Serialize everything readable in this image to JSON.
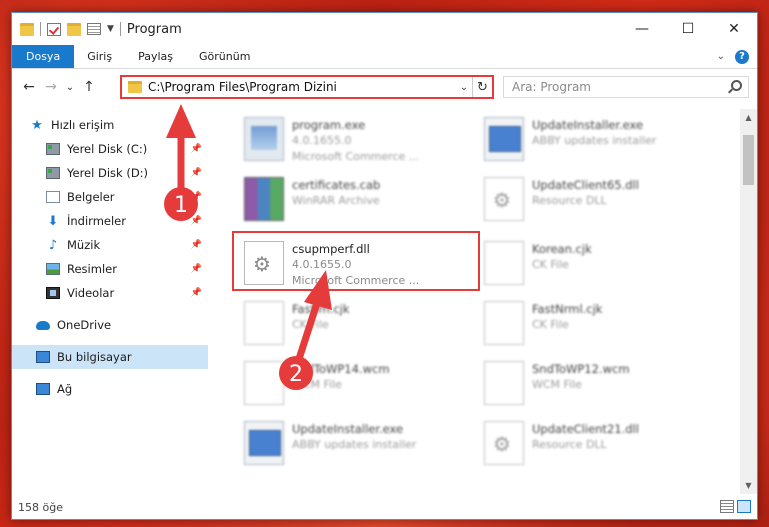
{
  "window": {
    "title": "Program",
    "controls": {
      "minimize": "—",
      "maximize": "☐",
      "close": "✕"
    }
  },
  "ribbon": {
    "tabs": [
      "Dosya",
      "Giriş",
      "Paylaş",
      "Görünüm"
    ],
    "expand_icon": "chevron-down-icon",
    "help_icon": "?"
  },
  "address": {
    "path": "C:\\Program Files\\Program Dizini",
    "dropdown": "⌄",
    "refresh": "↻"
  },
  "search": {
    "placeholder": "Ara: Program"
  },
  "nav": {
    "back": "←",
    "forward": "→",
    "recent": "⌄",
    "up": "↑"
  },
  "sidebar": {
    "items": [
      {
        "label": "Hızlı erişim",
        "icon": "star-icon",
        "pinned": false
      },
      {
        "label": "Yerel Disk (C:)",
        "icon": "disk-icon",
        "pinned": true
      },
      {
        "label": "Yerel Disk (D:)",
        "icon": "disk-icon",
        "pinned": true
      },
      {
        "label": "Belgeler",
        "icon": "documents-icon",
        "pinned": true
      },
      {
        "label": "İndirmeler",
        "icon": "download-icon",
        "pinned": true
      },
      {
        "label": "Müzik",
        "icon": "music-icon",
        "pinned": true
      },
      {
        "label": "Resimler",
        "icon": "pictures-icon",
        "pinned": true
      },
      {
        "label": "Videolar",
        "icon": "videos-icon",
        "pinned": true
      },
      {
        "label": "OneDrive",
        "icon": "cloud-icon",
        "pinned": false
      },
      {
        "label": "Bu bilgisayar",
        "icon": "computer-icon",
        "pinned": false,
        "selected": true
      },
      {
        "label": "Ağ",
        "icon": "network-icon",
        "pinned": false
      }
    ]
  },
  "files": [
    {
      "name": "program.exe",
      "line2": "4.0.1655.0",
      "line3": "Microsoft Commerce ...",
      "icon": "exe-icon",
      "blurred": true
    },
    {
      "name": "UpdateInstaller.exe",
      "line2": "ABBY updates installer",
      "line3": "",
      "icon": "installer-icon",
      "blurred": true
    },
    {
      "name": "certificates.cab",
      "line2": "WinRAR Archive",
      "line3": "",
      "icon": "archive-icon",
      "blurred": true
    },
    {
      "name": "UpdateClient65.dll",
      "line2": "Resource DLL",
      "line3": "",
      "icon": "dll-icon",
      "blurred": true
    },
    {
      "name": "csupmperf.dll",
      "line2": "4.0.1655.0",
      "line3": "Microsoft Commerce ...",
      "icon": "dll-icon",
      "blurred": false
    },
    {
      "name": "Korean.cjk",
      "line2": "CK File",
      "line3": "",
      "icon": "file-icon",
      "blurred": true
    },
    {
      "name": "FastIm.cjk",
      "line2": "CK File",
      "line3": "",
      "icon": "file-icon",
      "blurred": true
    },
    {
      "name": "FastNrml.cjk",
      "line2": "CK File",
      "line3": "",
      "icon": "file-icon",
      "blurred": true
    },
    {
      "name": "SndToWP14.wcm",
      "line2": "WCM File",
      "line3": "",
      "icon": "file-icon",
      "blurred": true
    },
    {
      "name": "SndToWP12.wcm",
      "line2": "WCM File",
      "line3": "",
      "icon": "file-icon",
      "blurred": true
    },
    {
      "name": "UpdateInstaller.exe",
      "line2": "ABBY updates installer",
      "line3": "",
      "icon": "installer-icon",
      "blurred": true
    },
    {
      "name": "UpdateClient21.dll",
      "line2": "Resource DLL",
      "line3": "",
      "icon": "dll-icon",
      "blurred": true
    }
  ],
  "status": {
    "count": "158 öğe"
  },
  "annotations": {
    "step1": "1",
    "step2": "2",
    "color": "#e53b3b"
  }
}
